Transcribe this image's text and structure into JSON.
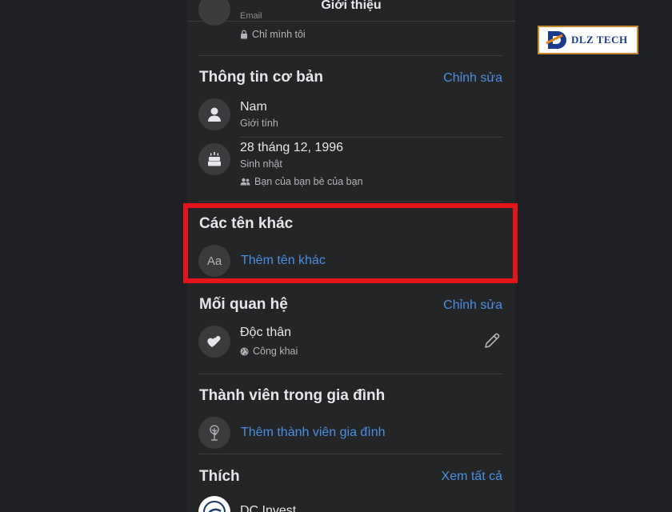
{
  "header": {
    "title": "Giới thiệu"
  },
  "top_partial": {
    "sub_text": "Email",
    "privacy": "Chỉ mình tôi"
  },
  "basic_info": {
    "title": "Thông tin cơ bản",
    "edit_label": "Chỉnh sửa",
    "gender": {
      "value": "Nam",
      "label": "Giới tính"
    },
    "birthday": {
      "value": "28 tháng 12, 1996",
      "label": "Sinh nhật",
      "privacy": "Bạn của bạn bè của bạn"
    }
  },
  "other_names": {
    "title": "Các tên khác",
    "icon_text": "Aa",
    "add_label": "Thêm tên khác"
  },
  "relationship": {
    "title": "Mối quan hệ",
    "edit_label": "Chỉnh sửa",
    "status": "Độc thân",
    "privacy": "Công khai"
  },
  "family": {
    "title": "Thành viên trong gia đình",
    "add_label": "Thêm thành viên gia đình"
  },
  "likes": {
    "title": "Thích",
    "see_all_label": "Xem tất cả",
    "first_item": "DC Invest"
  },
  "watermark": {
    "brand": "DLZ TECH"
  },
  "colors": {
    "accent": "#4a90e2",
    "highlight": "#e3151a",
    "background": "#242526"
  }
}
